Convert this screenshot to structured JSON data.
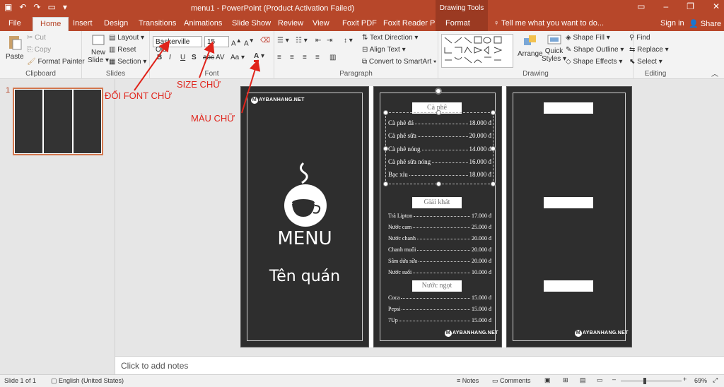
{
  "window": {
    "title": "menu1 - PowerPoint (Product Activation Failed)",
    "context_header": "Drawing Tools",
    "tell_me": "Tell me what you want to do...",
    "sign_in": "Sign in",
    "share": "Share"
  },
  "tabs": [
    "File",
    "Home",
    "Insert",
    "Design",
    "Transitions",
    "Animations",
    "Slide Show",
    "Review",
    "View",
    "Foxit PDF",
    "Foxit Reader PDF",
    "Format"
  ],
  "ribbon": {
    "clipboard": {
      "paste": "Paste",
      "cut": "Cut",
      "copy": "Copy",
      "format_painter": "Format Painter",
      "label": "Clipboard"
    },
    "slides": {
      "new_slide_1": "New",
      "new_slide_2": "Slide",
      "layout": "Layout",
      "reset": "Reset",
      "section": "Section",
      "label": "Slides"
    },
    "font": {
      "family": "Baskerville Old",
      "size": "15",
      "label": "Font"
    },
    "paragraph": {
      "text_direction": "Text Direction",
      "align_text": "Align Text",
      "smartart": "Convert to SmartArt",
      "label": "Paragraph"
    },
    "drawing": {
      "arrange": "Arrange",
      "quick_styles_1": "Quick",
      "quick_styles_2": "Styles",
      "shape_fill": "Shape Fill",
      "shape_outline": "Shape Outline",
      "shape_effects": "Shape Effects",
      "label": "Drawing"
    },
    "editing": {
      "find": "Find",
      "replace": "Replace",
      "select": "Select",
      "label": "Editing"
    }
  },
  "annotations": {
    "font": "ĐỔI FONT CHỮ",
    "size": "SIZE CHỮ",
    "color": "MÀU CHỮ",
    "arrow_color": "#e0241b"
  },
  "thumbnail": {
    "number": "1"
  },
  "slide": {
    "logo": "AYBANHANG.NET",
    "logo_letter": "M",
    "menu_title": "MENU",
    "shop_name": "Tên quán",
    "sections": [
      {
        "title": "Cà phê",
        "items": [
          {
            "name": "Cà phê đá",
            "price": "18.000 đ"
          },
          {
            "name": "Cà phê sữa",
            "price": "20.000 đ"
          },
          {
            "name": "Cà phê nóng",
            "price": "14.000 đ"
          },
          {
            "name": "Cà phê sữa nóng",
            "price": "16.000 đ"
          },
          {
            "name": "Bạc xỉu",
            "price": "18.000 đ"
          }
        ]
      },
      {
        "title": "Giải khát",
        "items": [
          {
            "name": "Trà Lipton",
            "price": "17.000 đ"
          },
          {
            "name": "Nước cam",
            "price": "25.000 đ"
          },
          {
            "name": "Nước chanh",
            "price": "20.000 đ"
          },
          {
            "name": "Chanh muối",
            "price": "20.000 đ"
          },
          {
            "name": "Sâm dứa sữa",
            "price": "20.000 đ"
          },
          {
            "name": "Nước suối",
            "price": "10.000 đ"
          }
        ]
      },
      {
        "title": "Nước ngọt",
        "items": [
          {
            "name": "Coca",
            "price": "15.000 đ"
          },
          {
            "name": "Pepsi",
            "price": "15.000 đ"
          },
          {
            "name": "7Up",
            "price": "15.000 đ"
          }
        ]
      }
    ]
  },
  "notes": {
    "placeholder": "Click to add notes"
  },
  "status": {
    "slide": "Slide 1 of 1",
    "language": "English (United States)",
    "notes": "Notes",
    "comments": "Comments",
    "zoom": "69%"
  },
  "colors": {
    "accent": "#b7472a",
    "board": "#2e2e2e"
  }
}
